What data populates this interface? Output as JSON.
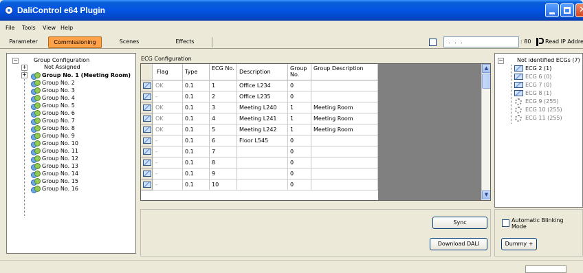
{
  "window": {
    "title": "DaliControl e64 Plugin"
  },
  "menu": [
    "File",
    "Tools",
    "View",
    "Help"
  ],
  "tabs": [
    "Parameter",
    "Commissioning",
    "Scenes",
    "Effects"
  ],
  "active_tab": "Commissioning",
  "ip_bar": {
    "address": ".   .   .",
    "port": ": 80",
    "read_label": "Read IP Address"
  },
  "tree": {
    "root": "Group Configuration",
    "items": [
      "Not Assigned",
      "Group No. 1 (Meeting Room)",
      "Group No. 2",
      "Group No. 3",
      "Group No. 4",
      "Group No. 5",
      "Group No. 6",
      "Group No. 7",
      "Group No. 8",
      "Group No. 9",
      "Group No. 10",
      "Group No. 11",
      "Group No. 12",
      "Group No. 13",
      "Group No. 14",
      "Group No. 15",
      "Group No. 16"
    ]
  },
  "ecg": {
    "label": "ECG Configuration",
    "columns": [
      "Flag",
      "Type",
      "ECG No.",
      "Description",
      "Group No.",
      "Group Description"
    ],
    "rows": [
      [
        "OK",
        "0.1",
        "1",
        "Office L234",
        "0",
        ""
      ],
      [
        "-",
        "0.1",
        "2",
        "Office L235",
        "0",
        ""
      ],
      [
        "OK",
        "0.1",
        "3",
        "Meeting L240",
        "1",
        "Meeting Room"
      ],
      [
        "OK",
        "0.1",
        "4",
        "Meeting L241",
        "1",
        "Meeting Room"
      ],
      [
        "OK",
        "0.1",
        "5",
        "Meeting L242",
        "1",
        "Meeting Room"
      ],
      [
        "-",
        "0.1",
        "6",
        "Floor L545",
        "0",
        ""
      ],
      [
        "-",
        "0.1",
        "7",
        "",
        "0",
        ""
      ],
      [
        "-",
        "0.1",
        "8",
        "",
        "0",
        ""
      ],
      [
        "-",
        "0.1",
        "9",
        "",
        "0",
        ""
      ],
      [
        "-",
        "0.1",
        "10",
        "",
        "0",
        ""
      ]
    ]
  },
  "buttons": {
    "sync": "Sync",
    "download": "Download DALI",
    "dummy": "Dummy +"
  },
  "auto_blink": "Automatic Blinking Mode",
  "not_identified": {
    "root": "Not identified ECGs (7)",
    "items": [
      "ECG 2 (1)",
      "ECG 6 (0)",
      "ECG 7 (0)",
      "ECG 8 (1)",
      "ECG 9 (255)",
      "ECG 10 (255)",
      "ECG 11 (255)"
    ]
  },
  "colors": {
    "titlebar": "#0554e3",
    "active_tab": "#ffa24a",
    "grid_bg": "#808080"
  }
}
